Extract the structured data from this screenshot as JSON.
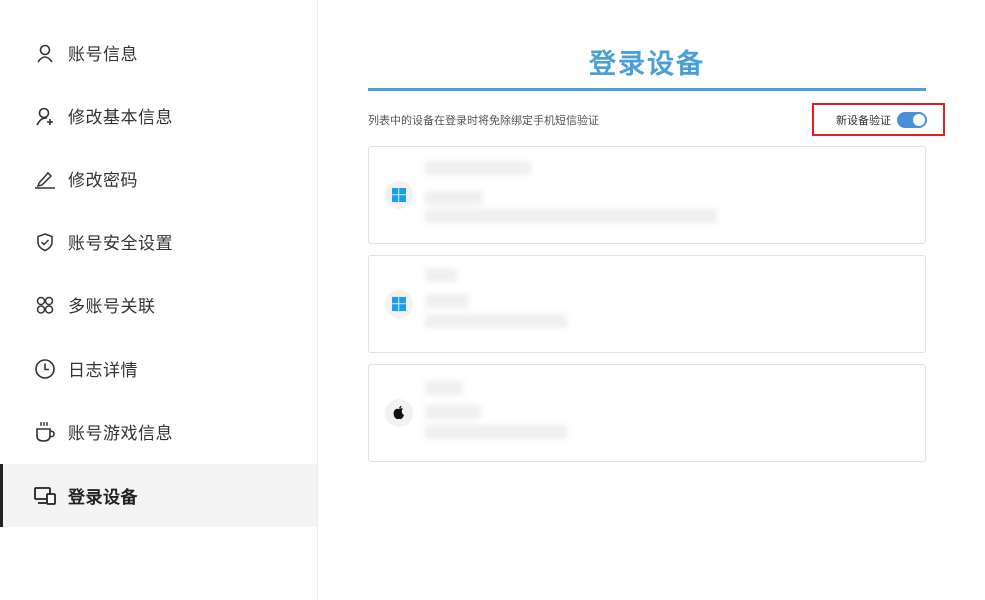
{
  "sidebar": {
    "items": [
      {
        "label": "账号信息",
        "icon": "user-icon"
      },
      {
        "label": "修改基本信息",
        "icon": "user-add-icon"
      },
      {
        "label": "修改密码",
        "icon": "pen-icon"
      },
      {
        "label": "账号安全设置",
        "icon": "shield-check-icon"
      },
      {
        "label": "多账号关联",
        "icon": "link-accounts-icon"
      },
      {
        "label": "日志详情",
        "icon": "clock-icon"
      },
      {
        "label": "账号游戏信息",
        "icon": "cup-icon"
      },
      {
        "label": "登录设备",
        "icon": "devices-icon",
        "active": true
      }
    ]
  },
  "main": {
    "title": "登录设备",
    "hint": "列表中的设备在登录时将免除绑定手机短信验证",
    "verify_label": "新设备验证",
    "verify_enabled": true
  },
  "devices": [
    {
      "os_icon": "windows-icon"
    },
    {
      "os_icon": "windows-icon"
    },
    {
      "os_icon": "apple-icon"
    }
  ],
  "colors": {
    "accent": "#4a9fd8",
    "toggle": "#4a90d9",
    "highlight_border": "#e02020",
    "windows": "#1aa0e8"
  }
}
